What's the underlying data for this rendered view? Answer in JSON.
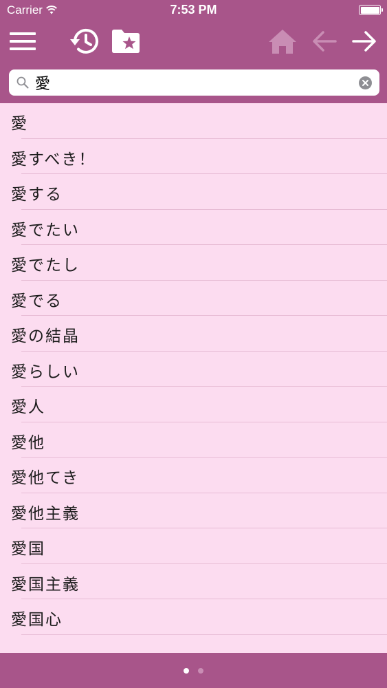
{
  "status_bar": {
    "carrier": "Carrier",
    "time": "7:53 PM",
    "battery_level": 1.0
  },
  "toolbar": {
    "menu_icon": "hamburger-menu-icon",
    "history_icon": "history-icon",
    "favorites_icon": "folder-star-icon",
    "home_icon": "home-icon",
    "back_icon": "arrow-left-icon",
    "forward_icon": "arrow-right-icon",
    "home_enabled": false,
    "back_enabled": false,
    "forward_enabled": true
  },
  "search": {
    "value": "愛",
    "search_icon": "magnifier-icon",
    "clear_icon": "clear-circle-icon"
  },
  "results": [
    "愛",
    "愛すべき！",
    "愛する",
    "愛でたい",
    "愛でたし",
    "愛でる",
    "愛の結晶",
    "愛らしい",
    "愛人",
    "愛他",
    "愛他てき",
    "愛他主義",
    "愛国",
    "愛国主義",
    "愛国心"
  ],
  "page_control": {
    "pages": 2,
    "current": 1
  },
  "colors": {
    "bar": "#a8558a",
    "list_background": "#fcdcf0",
    "separator": "#e7bcd5",
    "icon_active": "#ffffff",
    "icon_disabled": "#c98db4"
  }
}
